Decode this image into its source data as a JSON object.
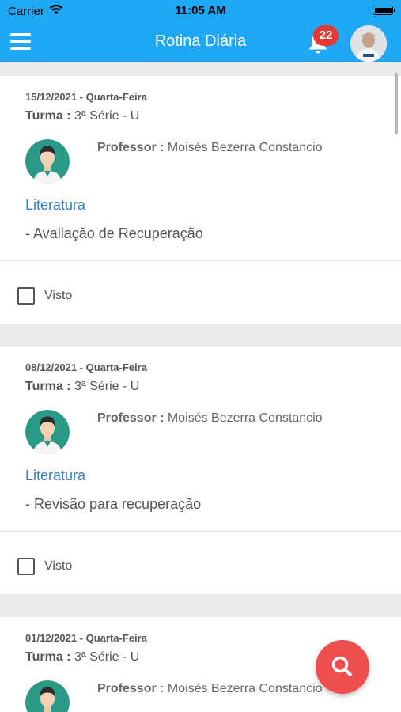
{
  "status_bar": {
    "carrier": "Carrier",
    "time": "11:05 AM"
  },
  "header": {
    "title": "Rotina Diária",
    "notification_count": "22"
  },
  "cards": [
    {
      "date": "15/12/2021 - Quarta-Feira",
      "turma_label": "Turma :",
      "turma_value": "3ª Série - U",
      "professor_label": "Professor :",
      "professor_name": "Moisés Bezerra Constancio",
      "subject": "Literatura",
      "description": "- Avaliação de Recuperação",
      "visto_label": "Visto"
    },
    {
      "date": "08/12/2021 - Quarta-Feira",
      "turma_label": "Turma :",
      "turma_value": "3ª Série - U",
      "professor_label": "Professor :",
      "professor_name": "Moisés Bezerra Constancio",
      "subject": "Literatura",
      "description": "- Revisão para recuperação",
      "visto_label": "Visto"
    },
    {
      "date": "01/12/2021 - Quarta-Feira",
      "turma_label": "Turma :",
      "turma_value": "3ª Série - U",
      "professor_label": "Professor :",
      "professor_name": "Moisés Bezerra Constancio"
    }
  ],
  "icons": {
    "menu": "menu-icon",
    "bell": "bell-icon",
    "user_avatar": "avatar-photo",
    "professor_avatar": "professor-avatar-icon",
    "fab": "search-icon",
    "checkbox": "checkbox-icon"
  },
  "colors": {
    "header": "#1ea7f2",
    "badge": "#e53935",
    "subject_link": "#2f82c8",
    "fab": "#ef4f4f",
    "avatar_bg": "#2a9a86"
  }
}
